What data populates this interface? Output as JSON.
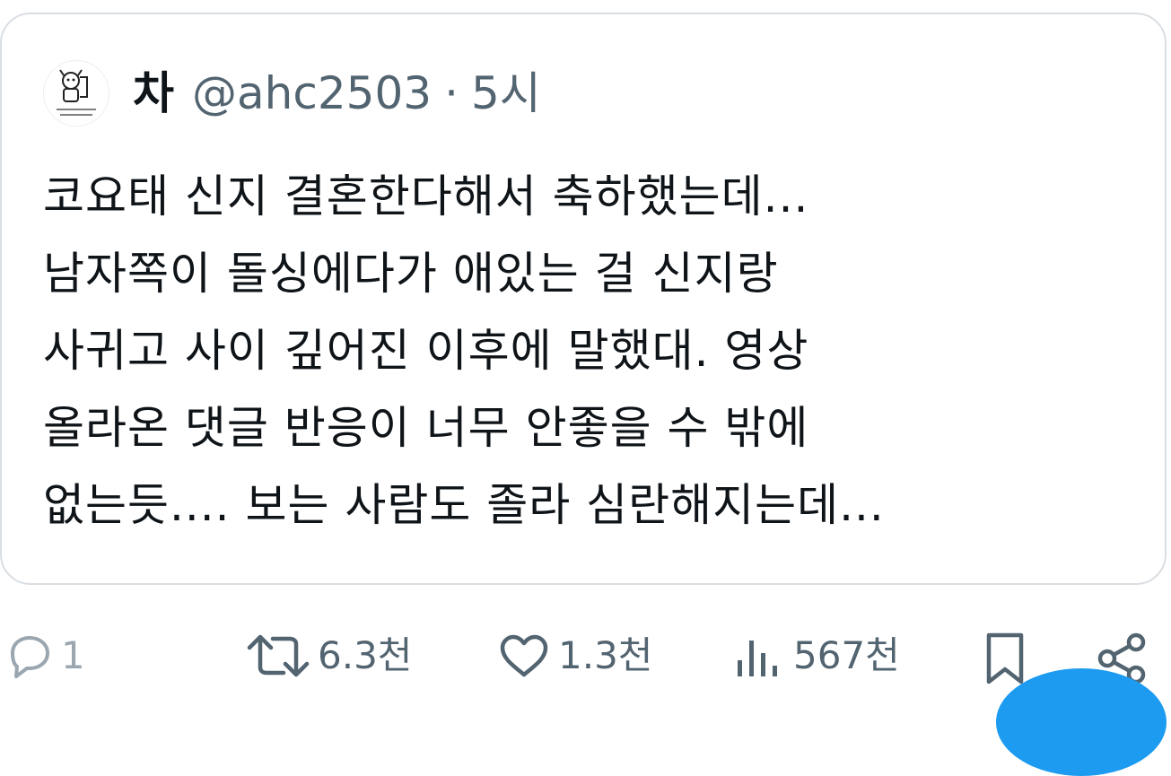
{
  "tweet": {
    "display_name": "차",
    "handle": "@ahc2503",
    "separator": "·",
    "time": "5시",
    "text_lines": [
      "코요태 신지 결혼한다해서 축하했는데...",
      "남자쪽이 돌싱에다가 애있는 걸 신지랑",
      "사귀고 사이 깊어진 이후에 말했대. 영상",
      "올라온 댓글 반응이 너무 안좋을 수 밖에",
      "없는듯.... 보는 사람도 졸라 심란해지는데..."
    ]
  },
  "actions": {
    "reply_count": "1",
    "retweet_count": "6.3천",
    "like_count": "1.3천",
    "views_count": "567천"
  },
  "icons": {
    "reply": "reply-icon",
    "retweet": "retweet-icon",
    "like": "heart-icon",
    "views": "views-icon",
    "bookmark": "bookmark-icon",
    "share": "share-icon"
  },
  "colors": {
    "text_primary": "#0f1419",
    "text_secondary": "#536471",
    "border": "#d9dee3",
    "accent": "#1d9bf0"
  }
}
